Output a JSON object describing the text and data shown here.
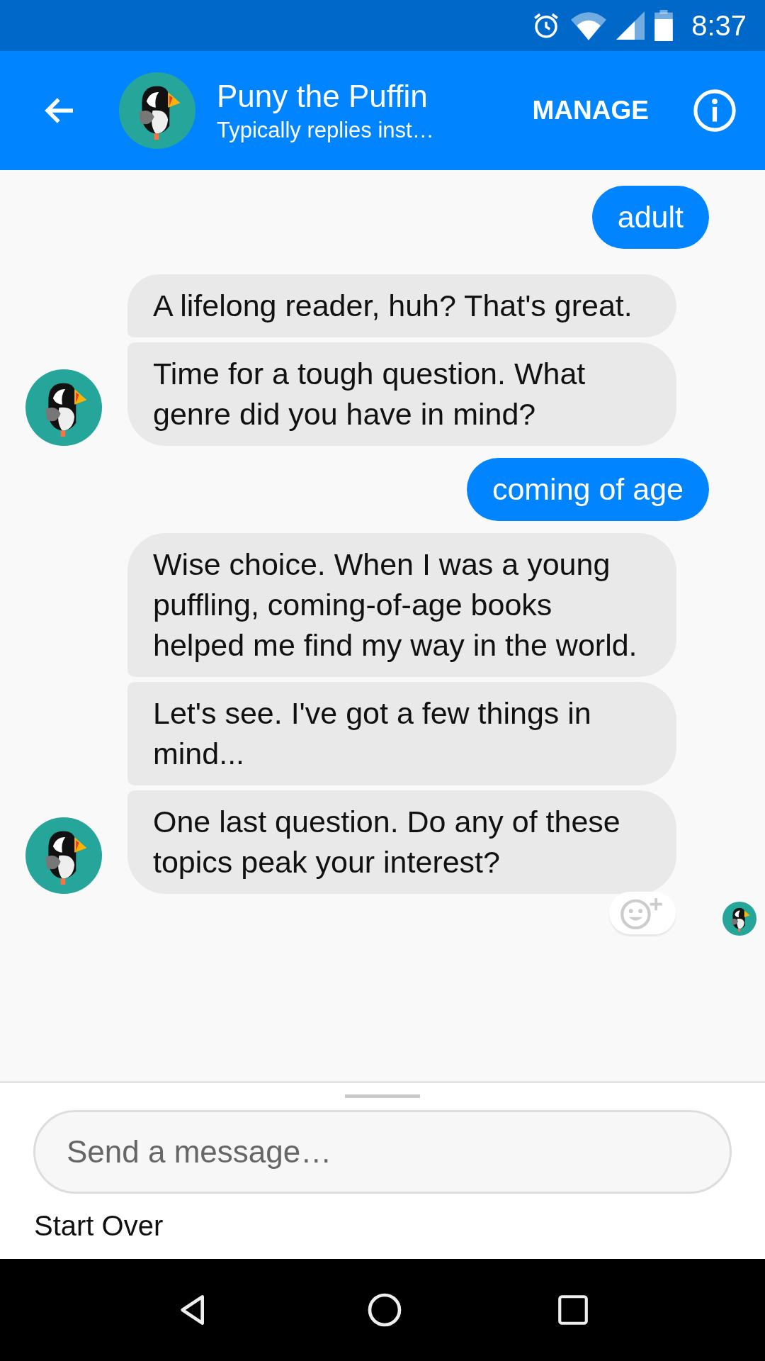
{
  "status_bar": {
    "time": "8:37"
  },
  "header": {
    "title": "Puny the Puffin",
    "subtitle": "Typically replies inst…",
    "action": "MANAGE"
  },
  "messages": [
    {
      "kind": "sent",
      "text": "adult"
    },
    {
      "kind": "received",
      "text": "A lifelong reader, huh? That's great.",
      "avatar": false
    },
    {
      "kind": "received",
      "text": "Time for a tough question. What genre did you have in mind?",
      "avatar": true
    },
    {
      "kind": "sent",
      "text": "coming of age"
    },
    {
      "kind": "received",
      "text": "Wise choice. When I was a young puffling, coming-of-age books helped me find my way in the world.",
      "avatar": false
    },
    {
      "kind": "received",
      "text": "Let's see. I've got a few things in mind...",
      "avatar": false
    },
    {
      "kind": "received",
      "text": "One last question. Do any of these topics peak your interest?",
      "avatar": true
    }
  ],
  "composer": {
    "placeholder": "Send a message…"
  },
  "quick_reply": "Start Over"
}
